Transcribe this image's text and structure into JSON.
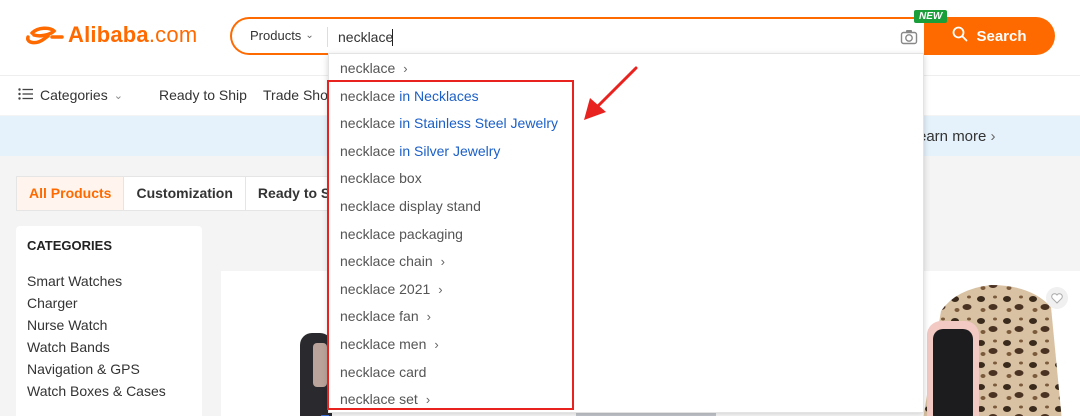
{
  "header": {
    "logo_brand": "Alibaba",
    "logo_suffix": ".com",
    "products_label": "Products",
    "search_value": "necklace",
    "search_button": "Search",
    "new_badge": "NEW"
  },
  "nav": {
    "categories": "Categories",
    "ready_to_ship": "Ready to Ship",
    "trade_shows": "Trade Show"
  },
  "banner": {
    "learn_more": "earn more"
  },
  "tabs": [
    "All Products",
    "Customization",
    "Ready to Ship"
  ],
  "categories": {
    "title": "CATEGORIES",
    "items": [
      "Smart Watches",
      "Charger",
      "Nurse Watch",
      "Watch Bands",
      "Navigation & GPS",
      "Watch Boxes & Cases"
    ]
  },
  "suggestions": [
    {
      "text": "necklace",
      "cat": "",
      "arrow": true
    },
    {
      "text": "necklace",
      "cat": "in Necklaces",
      "arrow": false
    },
    {
      "text": "necklace",
      "cat": "in Stainless Steel Jewelry",
      "arrow": false
    },
    {
      "text": "necklace",
      "cat": "in Silver Jewelry",
      "arrow": false
    },
    {
      "text": "necklace box",
      "cat": "",
      "arrow": false
    },
    {
      "text": "necklace display stand",
      "cat": "",
      "arrow": false
    },
    {
      "text": "necklace packaging",
      "cat": "",
      "arrow": false
    },
    {
      "text": "necklace chain",
      "cat": "",
      "arrow": true
    },
    {
      "text": "necklace 2021",
      "cat": "",
      "arrow": true
    },
    {
      "text": "necklace fan",
      "cat": "",
      "arrow": true
    },
    {
      "text": "necklace men",
      "cat": "",
      "arrow": true
    },
    {
      "text": "necklace card",
      "cat": "",
      "arrow": false
    },
    {
      "text": "necklace set",
      "cat": "",
      "arrow": true
    }
  ],
  "colors": {
    "brand_orange": "#ff6a00",
    "link_blue": "#1b5fc7",
    "highlight_red": "#e8231f",
    "new_green": "#1a9e3a"
  },
  "icons": [
    "alibaba-logo-icon",
    "camera-icon",
    "search-icon",
    "menu-icon",
    "chevron-down-icon",
    "chevron-right-icon",
    "heart-icon",
    "arrow-annotation-icon"
  ]
}
